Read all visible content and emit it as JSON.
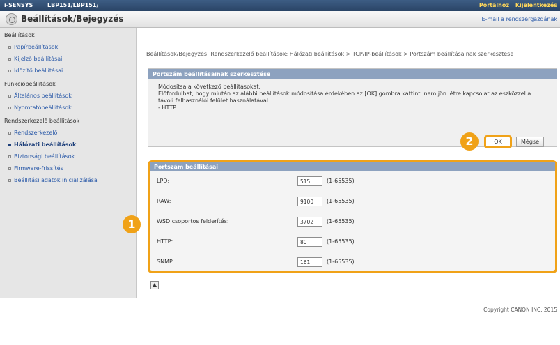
{
  "header": {
    "brand": "i-SENSYS",
    "model": "LBP151/LBP151/",
    "link_portal": "Portálhoz",
    "link_logout": "Kijelentkezés"
  },
  "titlebar": {
    "title": "Beállítások/Bejegyzés",
    "mail_link": "E-mail a rendszergazdának"
  },
  "sidebar": {
    "settings_heading": "Beállítások",
    "settings_items": [
      "Papírbeállítások",
      "Kijelző beállításai",
      "Időzítő beállításai"
    ],
    "functions_heading": "Funkcióbeállítások",
    "functions_items": [
      "Általános beállítások",
      "Nyomtatóbeállítások"
    ],
    "admin_heading": "Rendszerkezelő beállítások",
    "admin_items": [
      "Rendszerkezelő",
      "Hálózati beállítások",
      "Biztonsági beállítások",
      "Firmware-frissítés",
      "Beállítási adatok inicializálása"
    ]
  },
  "breadcrumb": "Beállítások/Bejegyzés: Rendszerkezelő beállítások: Hálózati beállítások > TCP/IP-beállítások > Portszám beállításainak szerkesztése",
  "edit_panel": {
    "header": "Portszám beállításainak szerkesztése",
    "line1": "Módosítsa a következő beállításokat.",
    "line2": "Előfordulhat, hogy miután az alábbi beállítások módosítása érdekében az [OK] gombra kattint, nem jön létre kapcsolat az eszközzel a távoli felhasználói felület használatával.",
    "line3": "- HTTP",
    "ok_label": "OK",
    "cancel_label": "Mégse"
  },
  "port_settings": {
    "header": "Portszám beállításai",
    "rows": [
      {
        "label": "LPD:",
        "value": "515",
        "range": "(1-65535)"
      },
      {
        "label": "RAW:",
        "value": "9100",
        "range": "(1-65535)"
      },
      {
        "label": "WSD csoportos felderítés:",
        "value": "3702",
        "range": "(1-65535)"
      },
      {
        "label": "HTTP:",
        "value": "80",
        "range": "(1-65535)"
      },
      {
        "label": "SNMP:",
        "value": "161",
        "range": "(1-65535)"
      }
    ]
  },
  "callouts": {
    "one": "1",
    "two": "2"
  },
  "back_to_top": "▲",
  "copyright": "Copyright CANON INC. 2015",
  "colors": {
    "accent": "#f0a218",
    "panel_header": "#8da2bf",
    "topbar": "#2f4b70",
    "link": "#2b5aa8"
  }
}
